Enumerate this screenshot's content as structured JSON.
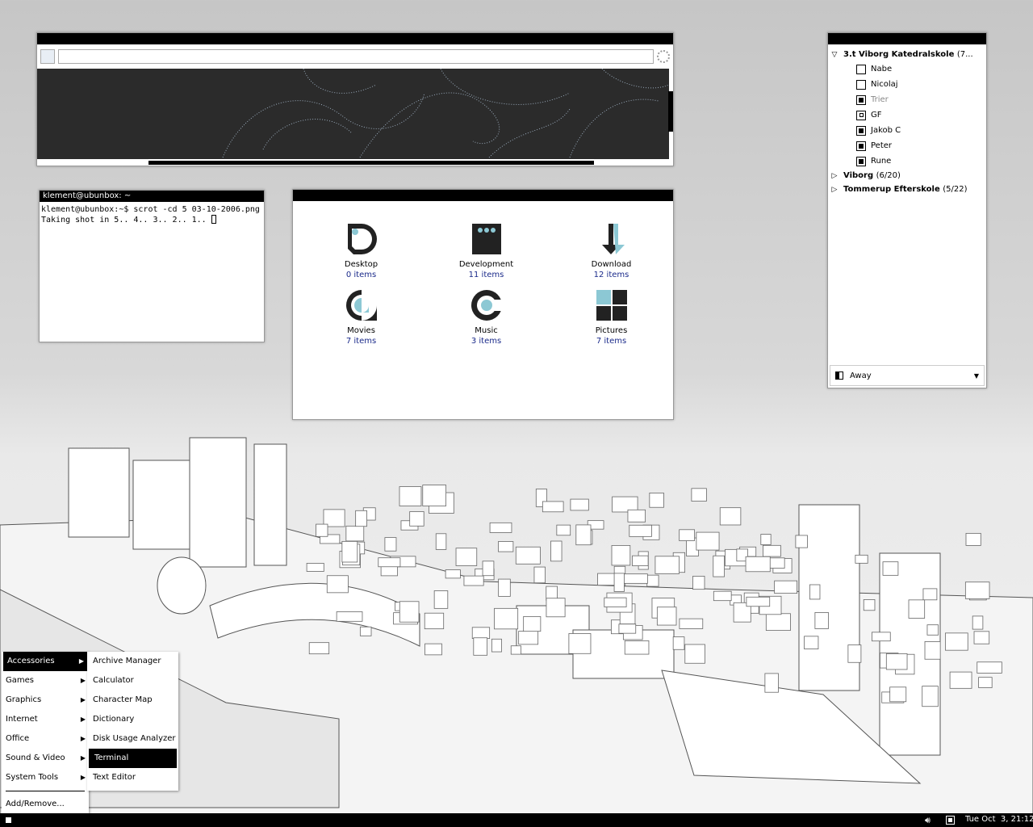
{
  "browser": {
    "url": ""
  },
  "terminal": {
    "title": "klement@ubunbox: ~",
    "lines": [
      "klement@ubunbox:~$ scrot -cd 5 03-10-2006.png",
      "Taking shot in 5.. 4.. 3.. 2.. 1.. "
    ]
  },
  "files": {
    "items": [
      {
        "name": "Desktop",
        "count": "0 items",
        "icon": "desktop-folder-icon"
      },
      {
        "name": "Development",
        "count": "11 items",
        "icon": "development-folder-icon"
      },
      {
        "name": "Download",
        "count": "12 items",
        "icon": "download-folder-icon"
      },
      {
        "name": "Movies",
        "count": "7 items",
        "icon": "movies-folder-icon"
      },
      {
        "name": "Music",
        "count": "3 items",
        "icon": "music-folder-icon"
      },
      {
        "name": "Pictures",
        "count": "7 items",
        "icon": "pictures-folder-icon"
      }
    ]
  },
  "buddy": {
    "groups": [
      {
        "name": "3.t Viborg Katedralskole",
        "count": "(7...",
        "expanded": true
      },
      {
        "name": "Viborg",
        "count": "(6/20)",
        "expanded": false
      },
      {
        "name": "Tommerup Efterskole",
        "count": "(5/22)",
        "expanded": false
      }
    ],
    "contacts": [
      {
        "name": "Nabe",
        "state": "offline"
      },
      {
        "name": "Nicolaj",
        "state": "offline"
      },
      {
        "name": "Trier",
        "state": "idle"
      },
      {
        "name": "GF",
        "state": "away"
      },
      {
        "name": "Jakob C",
        "state": "online"
      },
      {
        "name": "Peter",
        "state": "online"
      },
      {
        "name": "Rune",
        "state": "online"
      }
    ],
    "status": "Away"
  },
  "menu": {
    "categories": [
      "Accessories",
      "Games",
      "Graphics",
      "Internet",
      "Office",
      "Sound & Video",
      "System Tools"
    ],
    "add_remove": "Add/Remove...",
    "accessories": [
      "Archive Manager",
      "Calculator",
      "Character Map",
      "Dictionary",
      "Disk Usage Analyzer",
      "Terminal",
      "Text Editor"
    ],
    "selected_category": "Accessories",
    "selected_item": "Terminal"
  },
  "panel": {
    "clock": "Tue Oct  3, 21:12"
  }
}
